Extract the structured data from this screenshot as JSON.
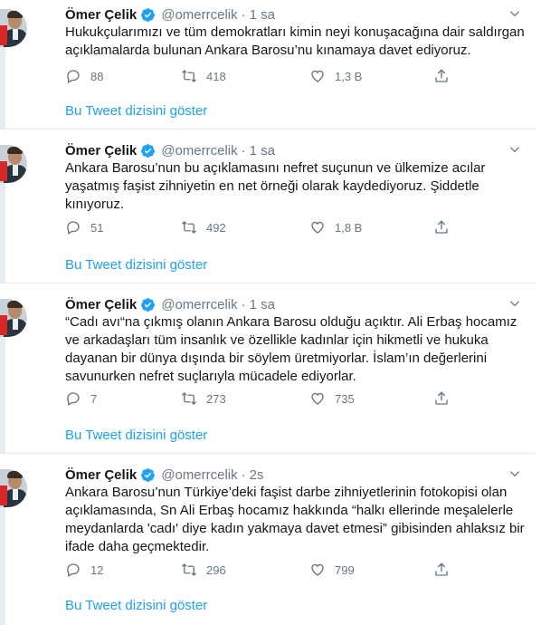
{
  "thread_link_label": "Bu Tweet dizisini göster",
  "tweets": [
    {
      "name": "Ömer Çelik",
      "handle": "@omerrcelik",
      "dot": "·",
      "time": "1 sa",
      "text": "Hukukçularımızı ve tüm demokratları kimin neyi konuşacağına dair saldırgan açıklamalarda bulunan Ankara Barosu’nu kınamaya davet ediyoruz.",
      "replies": "88",
      "retweets": "418",
      "likes": "1,3 B"
    },
    {
      "name": "Ömer Çelik",
      "handle": "@omerrcelik",
      "dot": "·",
      "time": "1 sa",
      "text": "Ankara Barosu’nun bu açıklamasını nefret suçunun ve ülkemize acılar yaşatmış faşist zihniyetin en net örneği olarak kaydediyoruz. Şiddetle kınıyoruz.",
      "replies": "51",
      "retweets": "492",
      "likes": "1,8 B"
    },
    {
      "name": "Ömer Çelik",
      "handle": "@omerrcelik",
      "dot": "·",
      "time": "1 sa",
      "text": "“Cadı avı“na çıkmış olanın Ankara Barosu olduğu açıktır. Ali Erbaş hocamız ve arkadaşları tüm insanlık ve özellikle kadınlar için hikmetli ve hukuka dayanan bir dünya dışında bir söylem üretmiyorlar. İslam’ın değerlerini savunurken nefret suçlarıyla mücadele ediyorlar.",
      "replies": "7",
      "retweets": "273",
      "likes": "735"
    },
    {
      "name": "Ömer Çelik",
      "handle": "@omerrcelik",
      "dot": "·",
      "time": "2s",
      "text": "Ankara Barosu’nun Türkiye’deki faşist darbe zihniyetlerinin fotokopisi olan açıklamasında, Sn Ali Erbaş hocamız hakkında “halkı ellerinde meşalelerle meydanlarda 'cadı' diye kadın yakmaya davet etmesi” gibisinden ahlaksız bir ifade daha geçmektedir.",
      "replies": "12",
      "retweets": "296",
      "likes": "799"
    }
  ],
  "icons": {
    "verified": "verified-badge-icon",
    "caret": "chevron-down-icon",
    "reply": "reply-icon",
    "retweet": "retweet-icon",
    "like": "heart-icon",
    "share": "share-icon"
  },
  "colors": {
    "accent": "#1da1f2",
    "muted": "#657786",
    "text": "#14171a",
    "divider": "#e6ecf0"
  }
}
